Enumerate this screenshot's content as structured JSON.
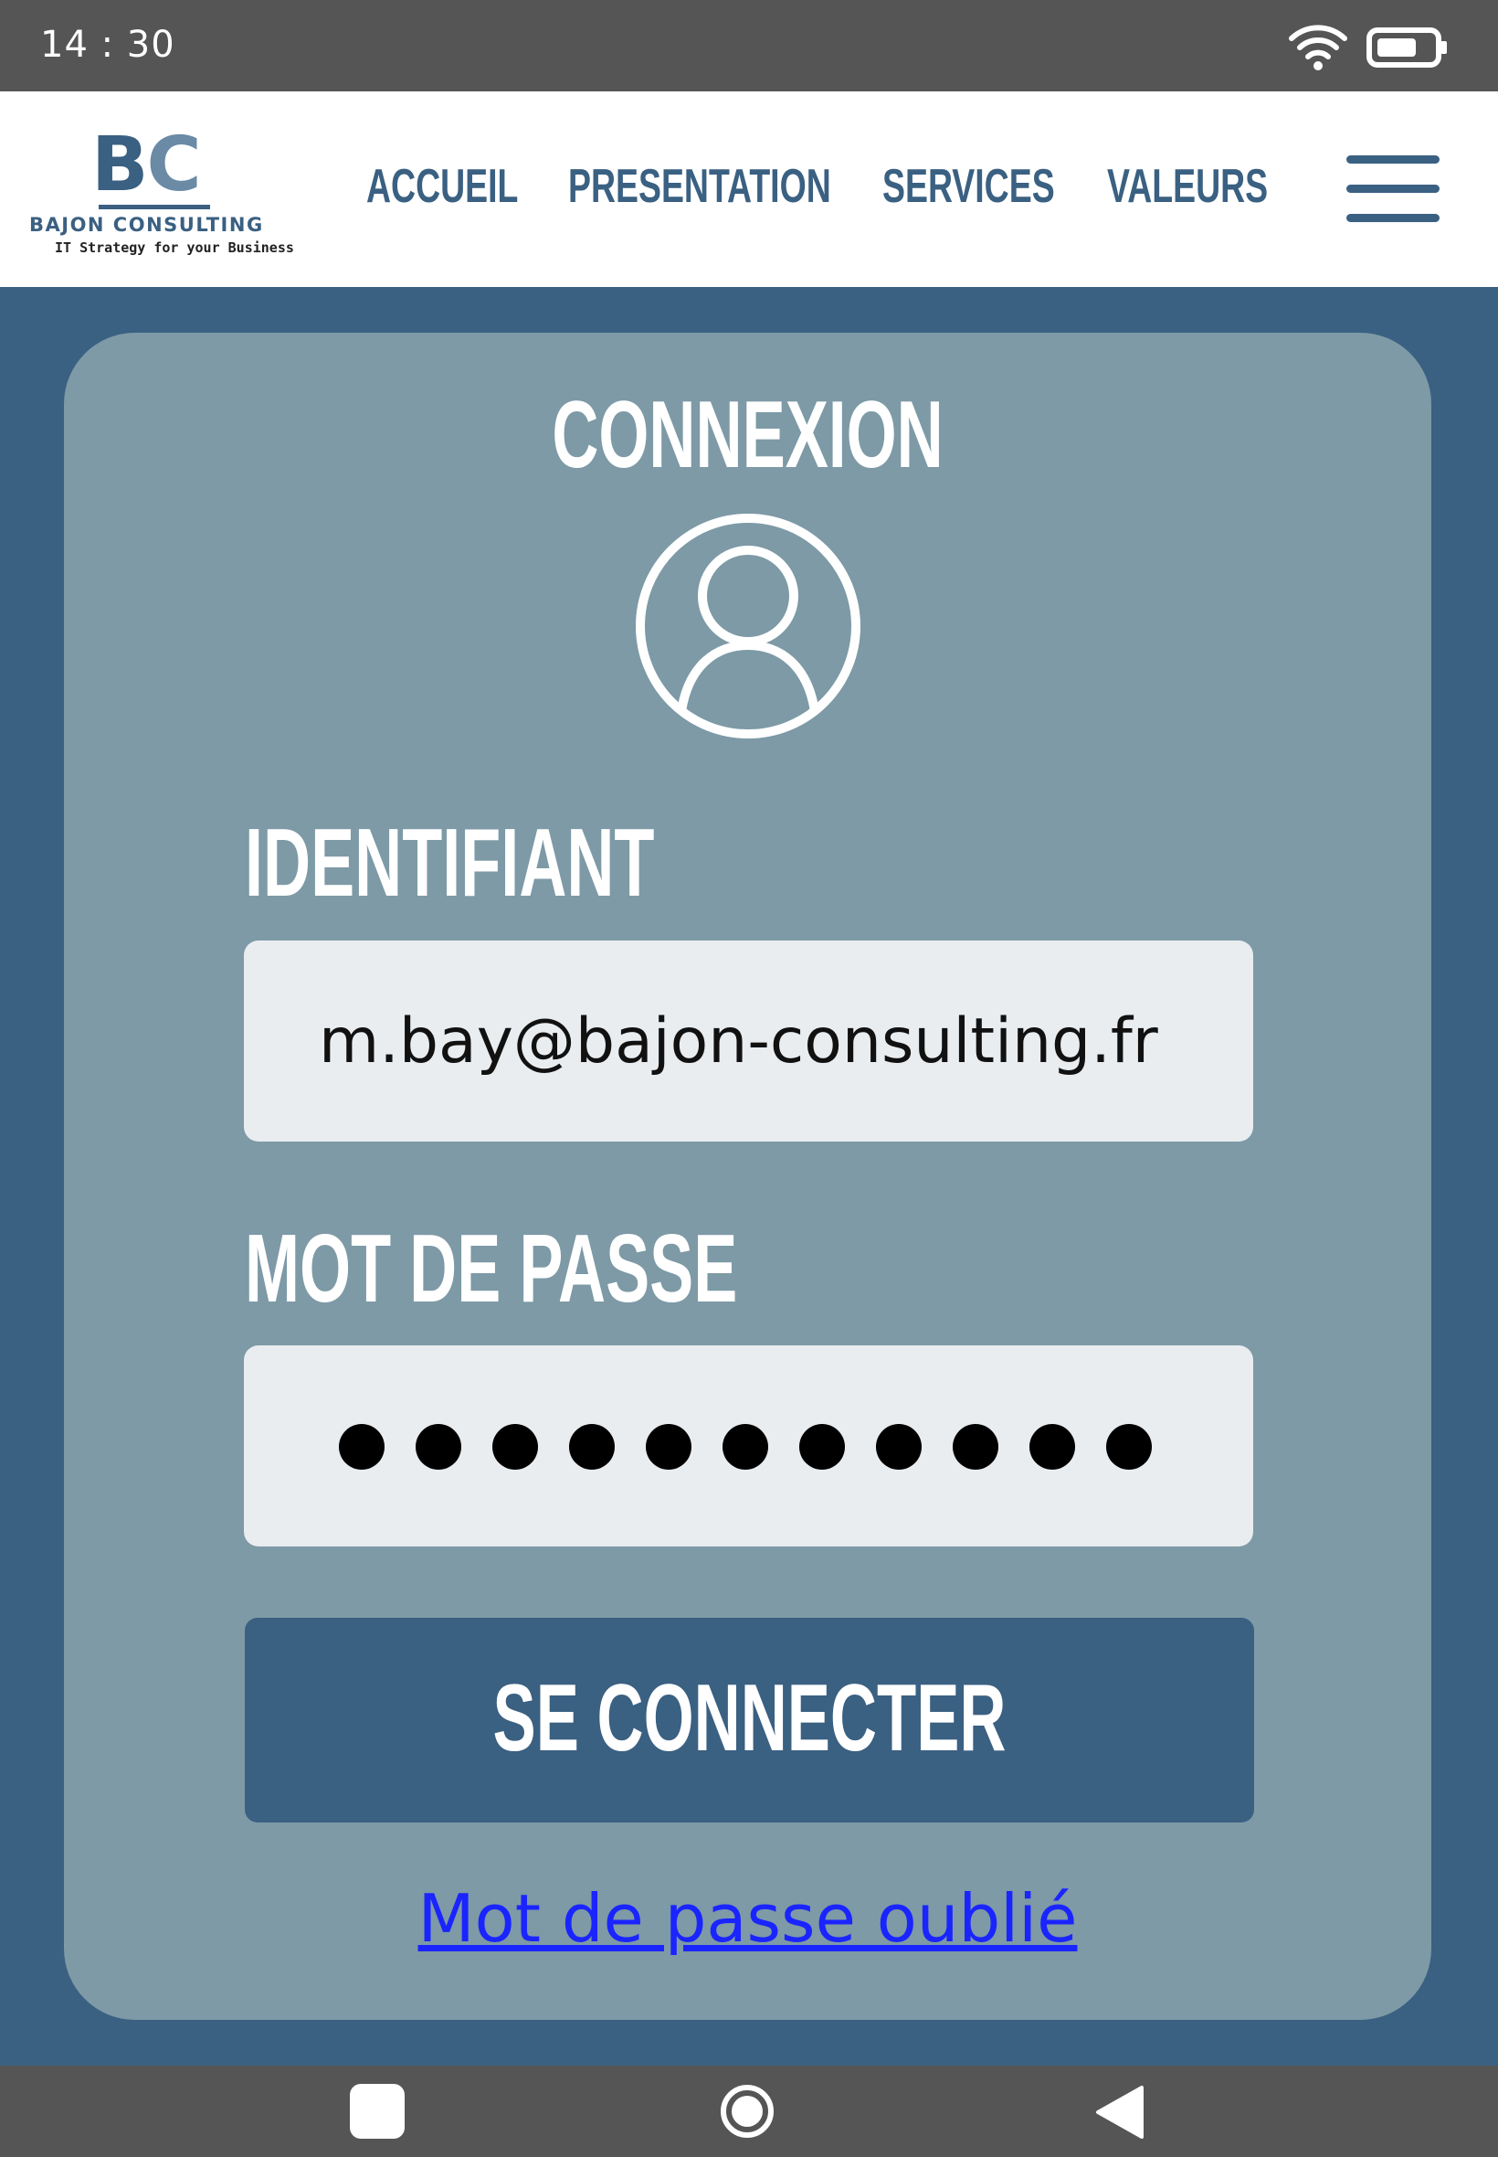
{
  "status_bar": {
    "time": "14 : 30",
    "icons": [
      "wifi-icon",
      "battery-icon"
    ]
  },
  "header": {
    "logo": {
      "mark": "BC",
      "name": "BAJON CONSULTING",
      "tagline": "IT Strategy for your Business"
    },
    "nav": {
      "home": "ACCUEIL",
      "presentation": "PRESENTATION",
      "services": "SERVICES",
      "values": "VALEURS"
    },
    "menu_icon": "hamburger-menu-icon"
  },
  "login": {
    "title": "CONNEXION",
    "avatar_icon": "user-circle-icon",
    "username_label": "IDENTIFIANT",
    "username_value": "m.bay@bajon-consulting.fr",
    "password_label": "MOT DE PASSE",
    "password_masked_length": 11,
    "submit_label": "SE CONNECTER",
    "forgot_link": "Mot de passe oublié"
  },
  "system_nav": {
    "icons": [
      "recent-apps-icon",
      "home-icon",
      "back-icon"
    ]
  },
  "colors": {
    "brand": "#3a6082",
    "card": "#7d9aa6",
    "input_bg": "#e9edf0",
    "link": "#1a24ff",
    "system_bars": "#555555"
  }
}
